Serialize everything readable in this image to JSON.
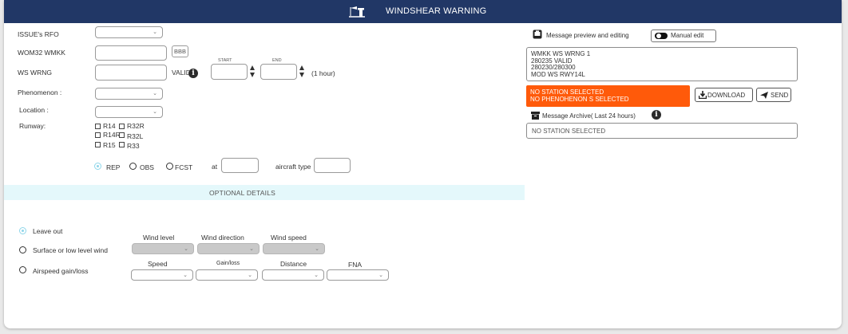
{
  "header": {
    "title": "WINDSHEAR WARNING",
    "icon": "windsock-runway-icon"
  },
  "form": {
    "issue_label": "ISSUE's RFO",
    "wom_label": "WOM32 WMKK",
    "bbb_label": "BBB",
    "wsw_label": "WS WRNG",
    "valid_label": "VALID",
    "start_label": "START",
    "end_label": "END",
    "hour_note": "(1 hour)",
    "phenomenon_label": "Phenomenon :",
    "location_label": "Location :",
    "runway_label": "Runway:",
    "runways": [
      "R14",
      "R32R",
      "R14R",
      "R32L",
      "R15",
      "R33"
    ],
    "obs_type": {
      "options": [
        "REP",
        "OBS",
        "FCST"
      ],
      "selected": "REP",
      "at_label": "at",
      "aircraft_label": "aircraft type"
    }
  },
  "optional": {
    "header": "OPTIONAL DETAILS",
    "options": [
      "Leave out",
      "Surface or low level wind",
      "Airspeed gain/loss"
    ],
    "selected": "Leave out",
    "wind_columns": [
      "Wind level",
      "Wind direction",
      "Wind speed"
    ],
    "airspeed_columns": [
      "Speed",
      "Gain/loss",
      "Distance",
      "FNA"
    ]
  },
  "preview": {
    "title": "Message preview and editing",
    "manual_edit_label": "Manual edit",
    "lines": [
      "WMKK WS WRNG 1",
      "280235 VALID",
      "280230/280300",
      "MOD WS RWY14L"
    ],
    "warning_lines": [
      "NO STATION SELECTED",
      "NO PHENOHENON S SELECTED"
    ],
    "download_label": "DOWNLOAD",
    "send_label": "SEND",
    "archive_title": "Message Archive( Last 24 hours)",
    "archive_value": "NO STATION SELECTED"
  },
  "colors": {
    "header_bg": "#213766",
    "warning_bg": "#ff5a0a",
    "optional_bar_bg": "#e4f8fb",
    "radio_selected": "#8fd6ea"
  }
}
